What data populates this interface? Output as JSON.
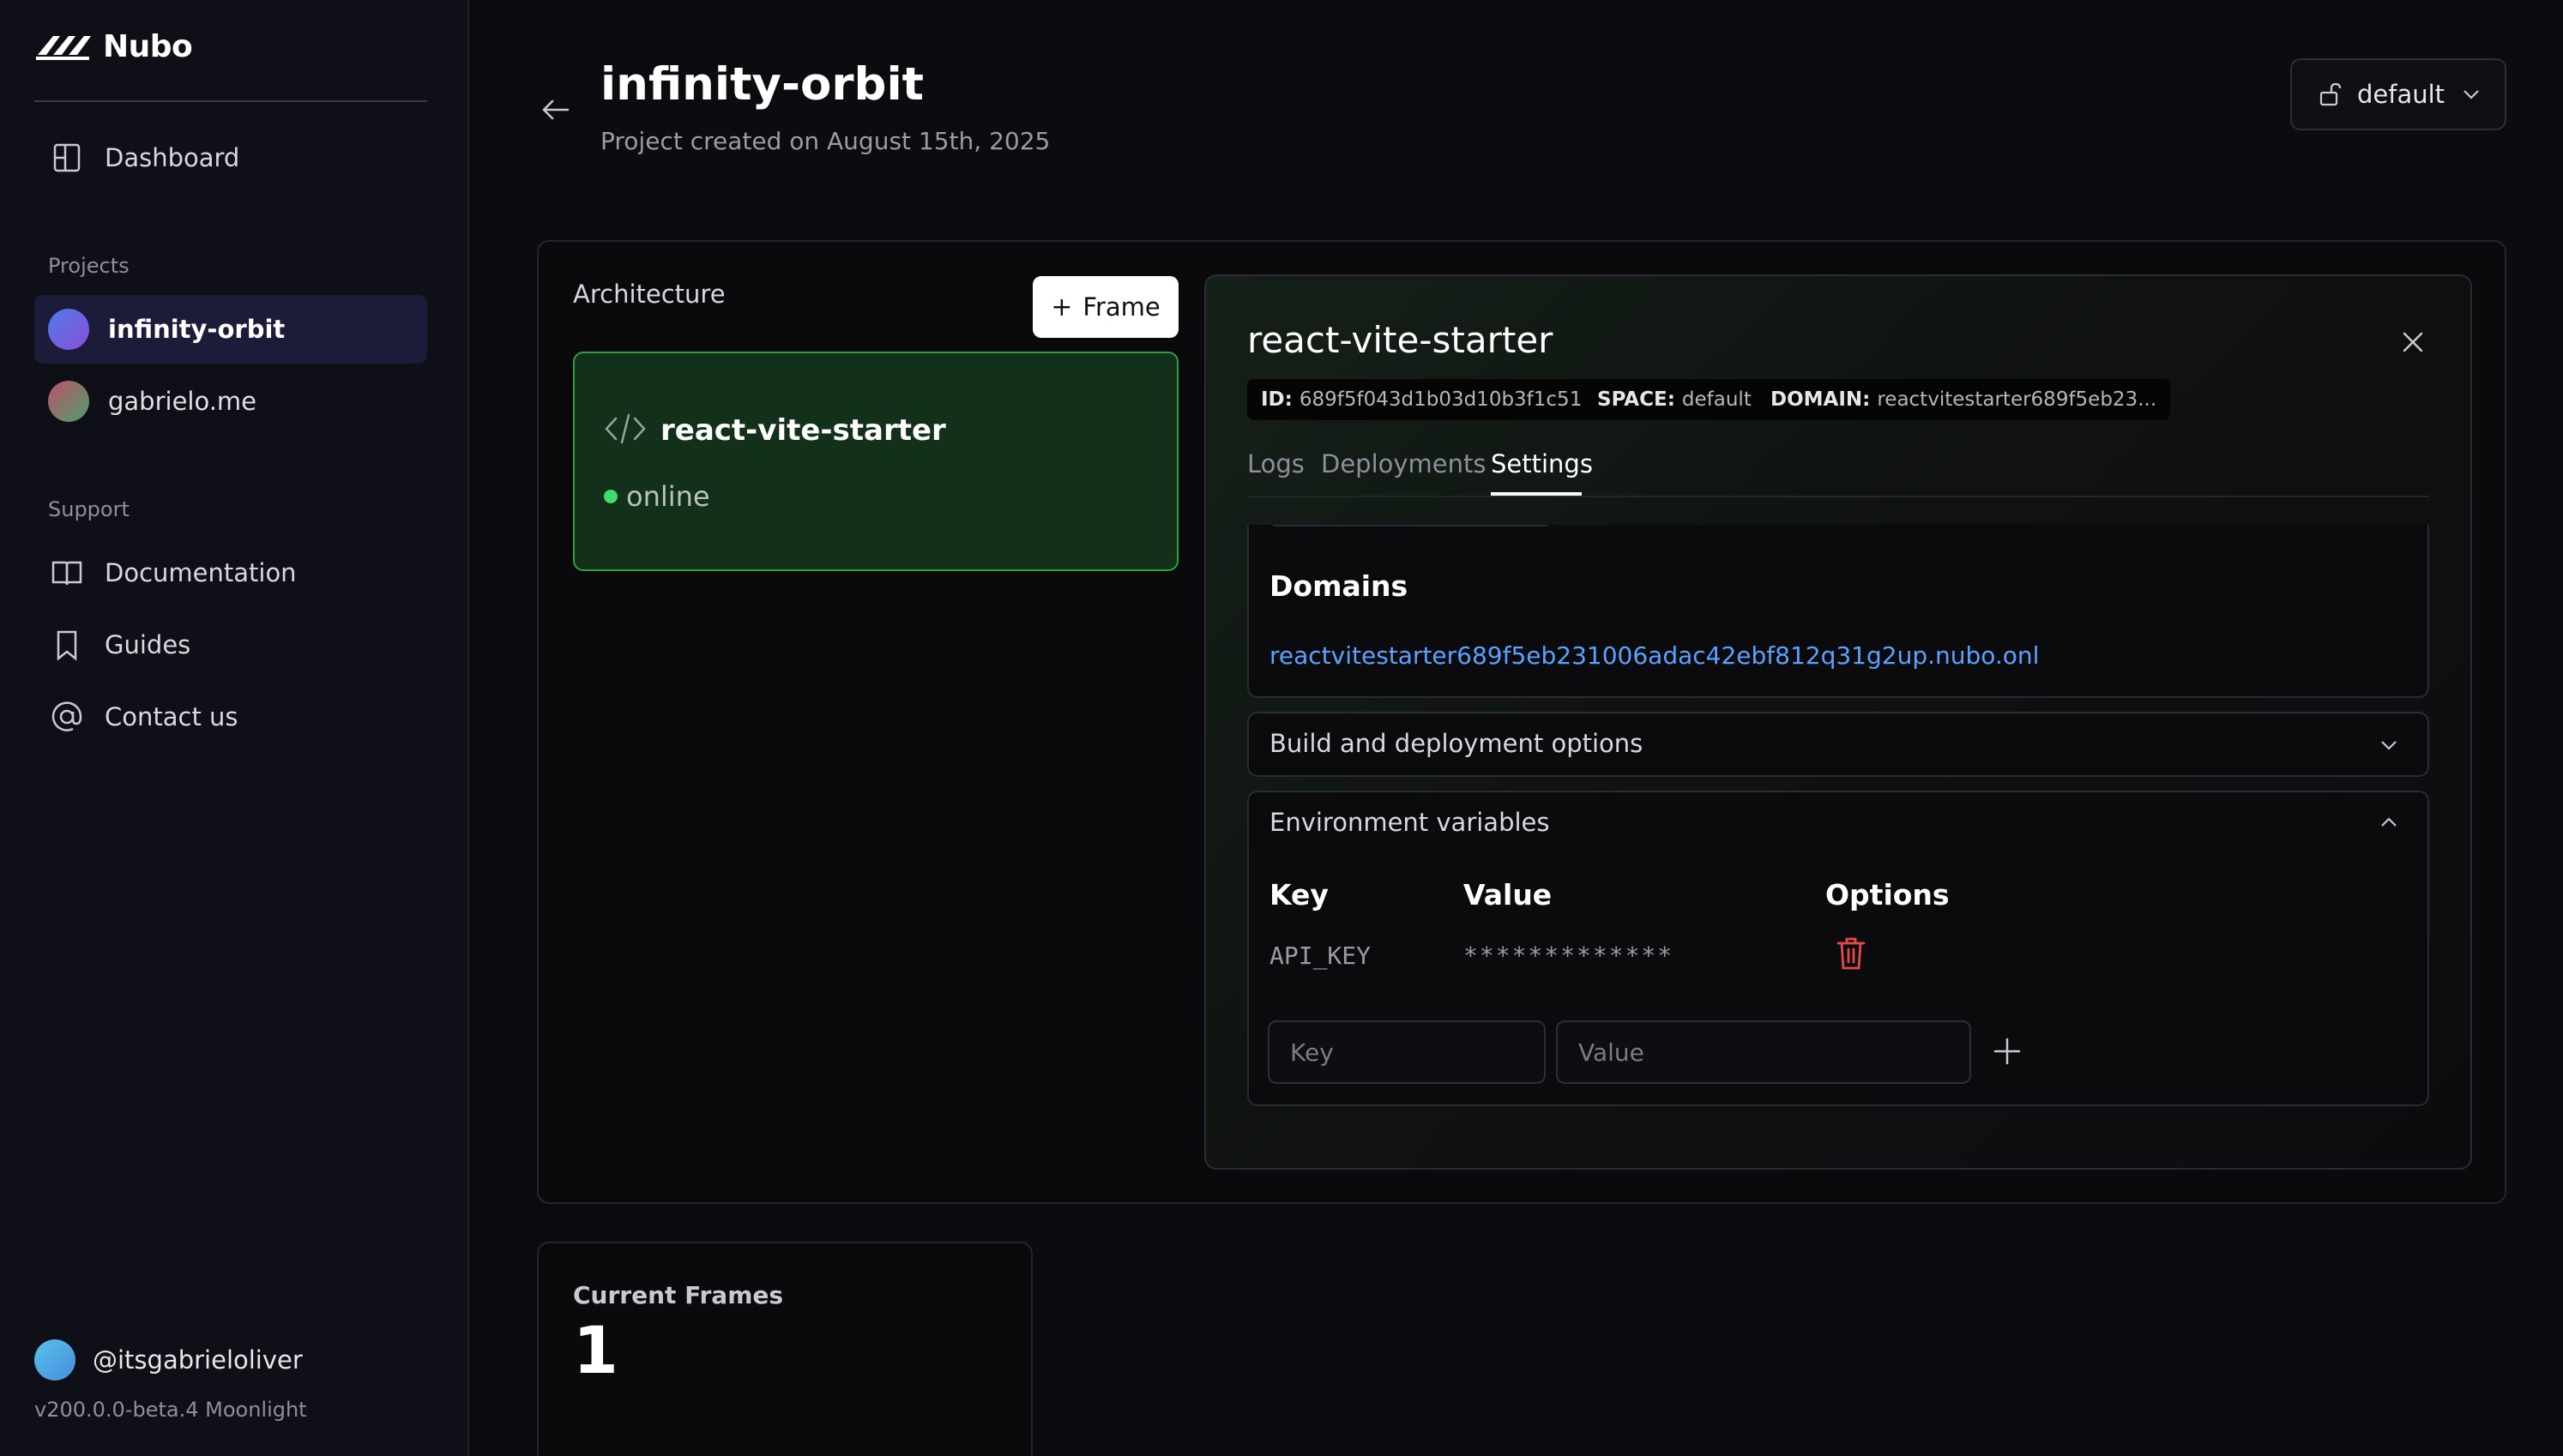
{
  "sidebar": {
    "brand": "Nubo",
    "dashboard_label": "Dashboard",
    "projects_heading": "Projects",
    "projects": [
      {
        "label": "infinity-orbit",
        "color": "#6c5ce7",
        "active": true
      },
      {
        "label": "gabrielo.me",
        "color": "#b05a7a",
        "active": false
      }
    ],
    "support_heading": "Support",
    "support_items": [
      {
        "label": "Documentation",
        "icon": "book-icon"
      },
      {
        "label": "Guides",
        "icon": "bookmark-icon"
      },
      {
        "label": "Contact us",
        "icon": "at-sign-icon"
      }
    ],
    "user": "@itsgabrieloliver",
    "version": "v200.0.0-beta.4 Moonlight"
  },
  "header": {
    "title": "infinity-orbit",
    "subtitle": "Project created on August 15th, 2025",
    "space_label": "default"
  },
  "architecture": {
    "label": "Architecture",
    "frame_button": "Frame",
    "frame": {
      "title": "react-vite-starter",
      "status": "online"
    }
  },
  "detail": {
    "title": "react-vite-starter",
    "badges": [
      {
        "key": "ID:",
        "value": "689f5f043d1b03d10b3f1c51"
      },
      {
        "key": "SPACE:",
        "value": "default"
      },
      {
        "key": "DOMAIN:",
        "value": "reactvitestarter689f5eb23..."
      }
    ],
    "tabs": [
      "Logs",
      "Deployments",
      "Settings"
    ],
    "active_tab": "Settings",
    "domains_title": "Domains",
    "domain_link": "reactvitestarter689f5eb231006adac42ebf812q31g2up.nubo.onl",
    "build_options_label": "Build and deployment options",
    "env": {
      "label": "Environment variables",
      "headers": {
        "key": "Key",
        "value": "Value",
        "options": "Options"
      },
      "rows": [
        {
          "key": "API_KEY",
          "value": "*************"
        }
      ],
      "key_placeholder": "Key",
      "value_placeholder": "Value"
    }
  },
  "stats": {
    "current_frames_label": "Current Frames",
    "current_frames_value": "1"
  }
}
